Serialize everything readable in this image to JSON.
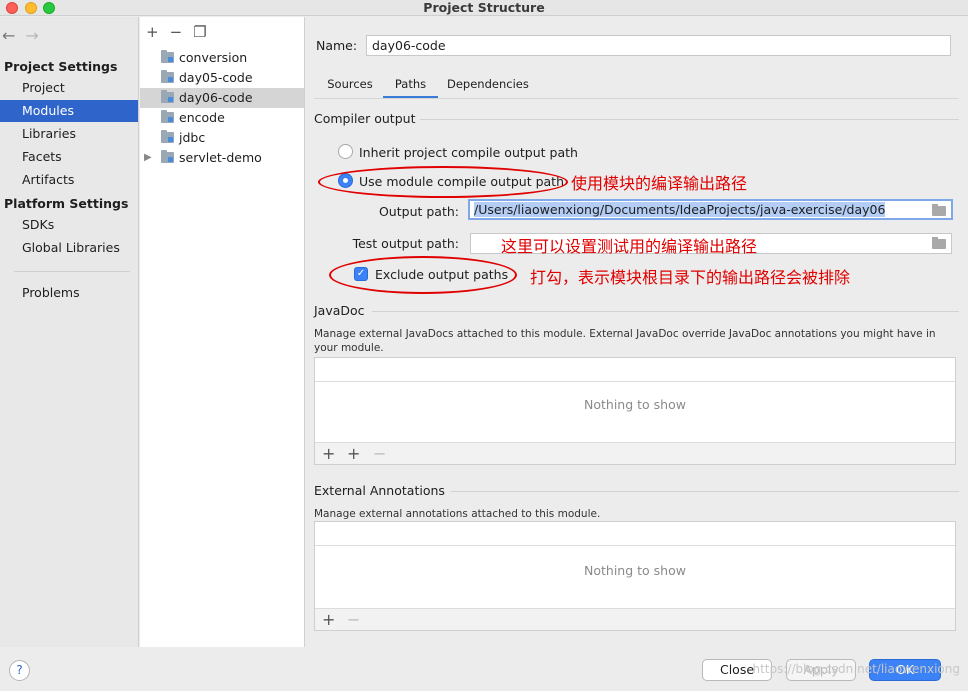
{
  "window": {
    "title": "Project Structure"
  },
  "nav": {
    "back_icon": "arrow-left-icon",
    "forward_icon": "arrow-right-icon",
    "project_settings_header": "Project Settings",
    "project_settings_items": [
      {
        "label": "Project",
        "selected": false
      },
      {
        "label": "Modules",
        "selected": true
      },
      {
        "label": "Libraries",
        "selected": false
      },
      {
        "label": "Facets",
        "selected": false
      },
      {
        "label": "Artifacts",
        "selected": false
      }
    ],
    "platform_settings_header": "Platform Settings",
    "platform_settings_items": [
      {
        "label": "SDKs"
      },
      {
        "label": "Global Libraries"
      }
    ],
    "problems_label": "Problems"
  },
  "modules": {
    "toolbar": {
      "add": "+",
      "remove": "−",
      "copy_icon": "copy-icon"
    },
    "items": [
      {
        "label": "conversion",
        "selected": false,
        "expandable": false
      },
      {
        "label": "day05-code",
        "selected": false,
        "expandable": false
      },
      {
        "label": "day06-code",
        "selected": true,
        "expandable": false
      },
      {
        "label": "encode",
        "selected": false,
        "expandable": false
      },
      {
        "label": "jdbc",
        "selected": false,
        "expandable": false
      },
      {
        "label": "servlet-demo",
        "selected": false,
        "expandable": true
      }
    ]
  },
  "content": {
    "name_label": "Name:",
    "name_value": "day06-code",
    "tabs": [
      {
        "label": "Sources",
        "active": false
      },
      {
        "label": "Paths",
        "active": true
      },
      {
        "label": "Dependencies",
        "active": false
      }
    ],
    "compiler_output": {
      "title": "Compiler output",
      "inherit_label": "Inherit project compile output path",
      "inherit_selected": false,
      "module_label": "Use module compile output path",
      "module_selected": true,
      "output_path_label": "Output path:",
      "output_path_value": "/Users/liaowenxiong/Documents/IdeaProjects/java-exercise/day06",
      "test_output_path_label": "Test output path:",
      "test_output_path_value": "",
      "exclude_label": "Exclude output paths",
      "exclude_checked": true
    },
    "javadoc": {
      "title": "JavaDoc",
      "description": "Manage external JavaDocs attached to this module. External JavaDoc override JavaDoc annotations you might have in your module.",
      "empty_text": "Nothing to show",
      "toolbar": {
        "add": "+",
        "add_url": "+",
        "remove": "−"
      }
    },
    "external_annotations": {
      "title": "External Annotations",
      "description": "Manage external annotations attached to this module.",
      "empty_text": "Nothing to show",
      "toolbar": {
        "add": "+",
        "remove": "−"
      }
    }
  },
  "annotations": {
    "module_path_note": "使用模块的编译输出路径",
    "test_path_note": "这里可以设置测试用的编译输出路径",
    "exclude_note": "打勾，表示模块根目录下的输出路径会被排除",
    "color": "#e00000"
  },
  "footer": {
    "help": "?",
    "close": "Close",
    "apply": "Apply",
    "ok": "OK",
    "watermark": "https://blog.csdn.net/liaowenxiong"
  },
  "colors": {
    "selection": "#2f65ca",
    "accent": "#3b82f6"
  }
}
